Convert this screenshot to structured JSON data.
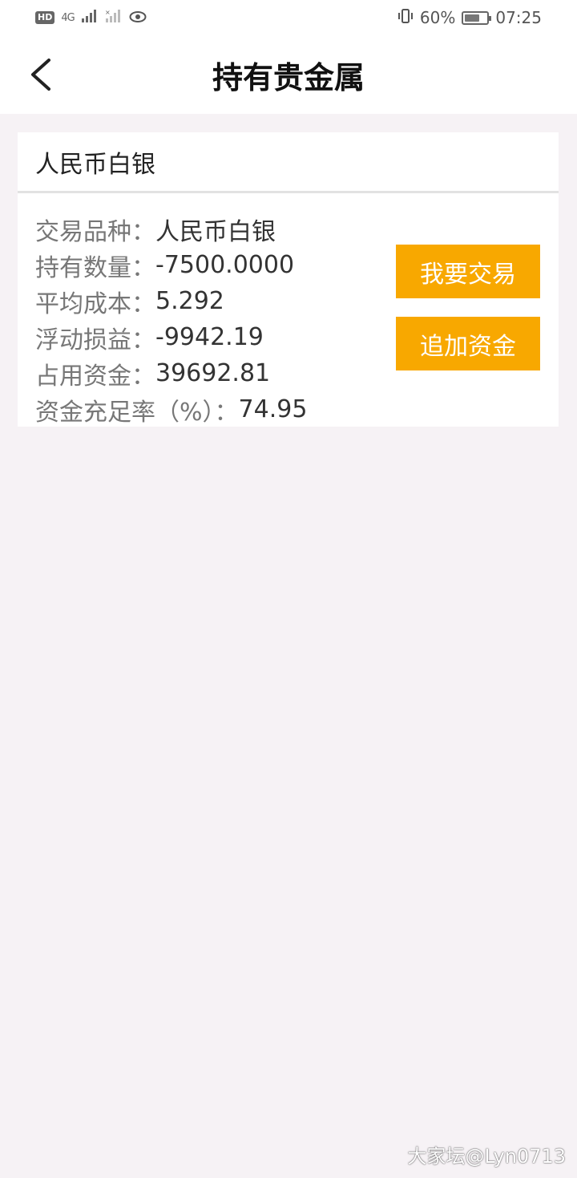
{
  "status_bar": {
    "hd_badge": "HD",
    "network": "4G",
    "signal_icon_1": "signal-bars-icon",
    "signal_icon_2": "signal-bars-no-service-icon",
    "eye_icon": "eye-icon",
    "vibrate_icon": "vibrate-icon",
    "battery_percent": "60%",
    "time": "07:25"
  },
  "nav": {
    "back_icon": "chevron-left-icon",
    "title": "持有贵金属"
  },
  "card": {
    "header": "人民币白银",
    "rows": [
      {
        "label": "交易品种：",
        "value": "人民币白银"
      },
      {
        "label": "持有数量：",
        "value": "-7500.0000"
      },
      {
        "label": "平均成本：",
        "value": "5.292"
      },
      {
        "label": "浮动损益：",
        "value": "-9942.19"
      },
      {
        "label": "占用资金：",
        "value": "39692.81"
      },
      {
        "label": "资金充足率（%）：",
        "value": "74.95"
      }
    ],
    "buttons": {
      "trade": "我要交易",
      "add_funds": "追加资金"
    },
    "colors": {
      "button_bg": "#f8a800",
      "button_text": "#ffffff"
    }
  },
  "watermark": "大家坛@Lyn0713"
}
